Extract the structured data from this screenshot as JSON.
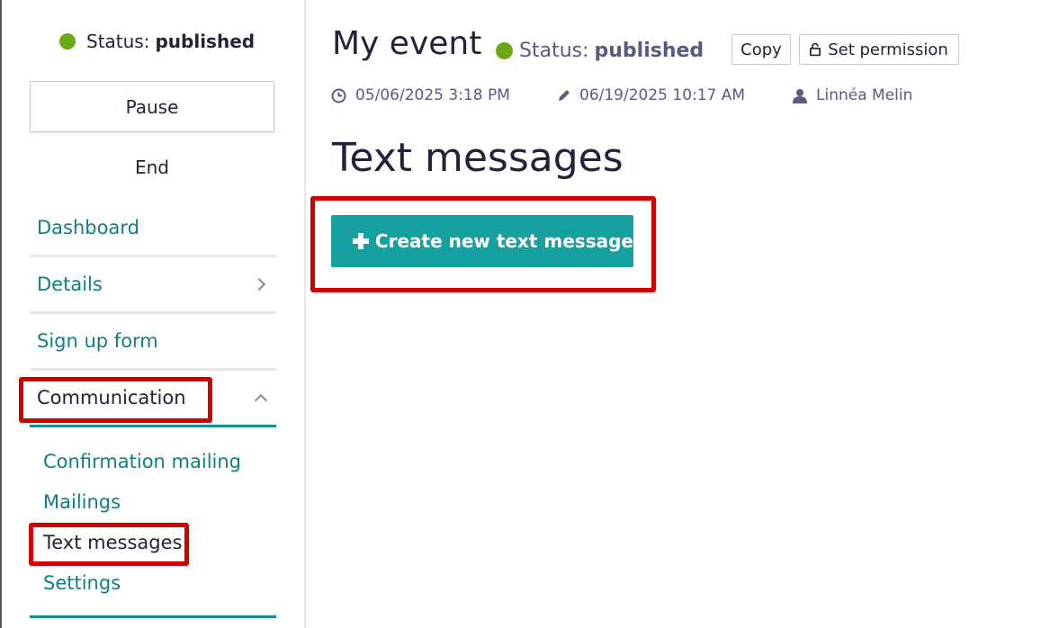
{
  "sidebar": {
    "status_label": "Status:",
    "status_value": "published",
    "pause_label": "Pause",
    "end_label": "End",
    "nav": {
      "dashboard": "Dashboard",
      "details": "Details",
      "signup": "Sign up form",
      "communication": "Communication"
    },
    "communication_items": {
      "confirmation": "Confirmation mailing",
      "mailings": "Mailings",
      "text_messages": "Text messages",
      "settings": "Settings"
    }
  },
  "header": {
    "title": "My event",
    "status_label": "Status:",
    "status_value": "published",
    "copy_label": "Copy",
    "permission_label": "Set permission",
    "created": "05/06/2025 3:18 PM",
    "modified": "06/19/2025 10:17 AM",
    "owner": "Linnéa Melin"
  },
  "main": {
    "section_title": "Text messages",
    "create_label": "Create new text message"
  },
  "colors": {
    "accent": "#16a0a0",
    "link": "#0f7f80",
    "status_green": "#6aa915",
    "highlight_red": "#d40000"
  },
  "icons": [
    "status-dot",
    "chevron-right-icon",
    "chevron-up-icon",
    "lock-icon",
    "clock-icon",
    "pencil-icon",
    "user-icon",
    "plus-icon"
  ]
}
